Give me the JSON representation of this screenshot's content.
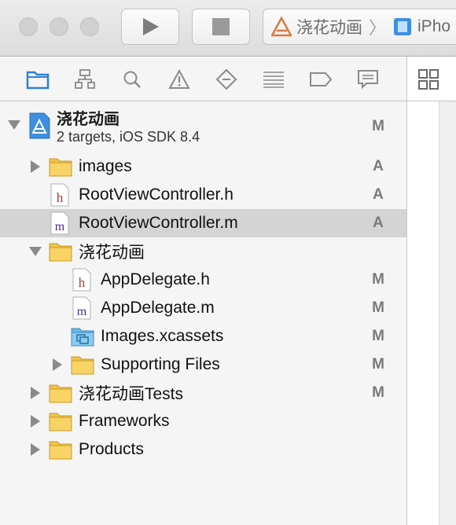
{
  "toolbar": {
    "scheme_project": "浇花动画",
    "scheme_device": "iPho"
  },
  "navigator": {
    "tabs": [
      "project-navigator",
      "symbol-navigator",
      "find-navigator",
      "issue-navigator",
      "test-navigator",
      "debug-navigator",
      "breakpoint-navigator",
      "report-navigator"
    ]
  },
  "tree": {
    "project": {
      "name": "浇花动画",
      "subtitle": "2 targets, iOS SDK 8.4",
      "status": "M"
    },
    "items": [
      {
        "label": "images",
        "kind": "folder",
        "status": "A"
      },
      {
        "label": "RootViewController.h",
        "kind": "h",
        "status": "A"
      },
      {
        "label": "RootViewController.m",
        "kind": "m",
        "status": "A",
        "selected": true
      },
      {
        "label": "浇花动画",
        "kind": "folder",
        "status": ""
      },
      {
        "label": "AppDelegate.h",
        "kind": "h",
        "status": "M"
      },
      {
        "label": "AppDelegate.m",
        "kind": "m",
        "status": "M"
      },
      {
        "label": "Images.xcassets",
        "kind": "assets",
        "status": "M"
      },
      {
        "label": "Supporting Files",
        "kind": "folder",
        "status": "M"
      },
      {
        "label": "浇花动画Tests",
        "kind": "folder",
        "status": "M"
      },
      {
        "label": "Frameworks",
        "kind": "folder",
        "status": ""
      },
      {
        "label": "Products",
        "kind": "folder",
        "status": ""
      }
    ]
  },
  "colors": {
    "folder": "#f0c44c",
    "selection": "#d4d4d4",
    "accent": "#2f7fd9"
  }
}
